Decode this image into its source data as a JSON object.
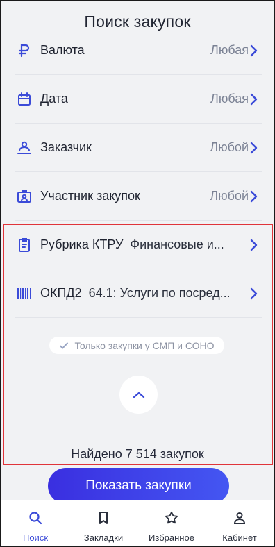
{
  "header": {
    "title": "Поиск закупок"
  },
  "filters": [
    {
      "icon": "ruble-icon",
      "label": "Валюта",
      "value": "Любая"
    },
    {
      "icon": "calendar-icon",
      "label": "Дата",
      "value": "Любая"
    },
    {
      "icon": "customer-icon",
      "label": "Заказчик",
      "value": "Любой"
    },
    {
      "icon": "participant-icon",
      "label": "Участник закупок",
      "value": "Любой"
    },
    {
      "icon": "clipboard-icon",
      "label": "Рубрика КТРУ",
      "value": "Финансовые и..."
    },
    {
      "icon": "barcode-icon",
      "label": "ОКПД2",
      "value": "64.1: Услуги по посред..."
    }
  ],
  "smp_filter": {
    "label": "Только закупки у СМП и СОНО",
    "checked": true
  },
  "results": {
    "found_text": "Найдено 7 514 закупок"
  },
  "show_button": {
    "label": "Показать закупки"
  },
  "tabs": [
    {
      "icon": "search-icon",
      "label": "Поиск",
      "active": true
    },
    {
      "icon": "bookmark-icon",
      "label": "Закладки",
      "active": false
    },
    {
      "icon": "star-icon",
      "label": "Избранное",
      "active": false
    },
    {
      "icon": "user-icon",
      "label": "Кабинет",
      "active": false
    }
  ],
  "colors": {
    "accent": "#3b4bd8",
    "highlight_border": "#e0343a",
    "button_gradient_start": "#3a2fe0",
    "button_gradient_end": "#4456f2"
  }
}
